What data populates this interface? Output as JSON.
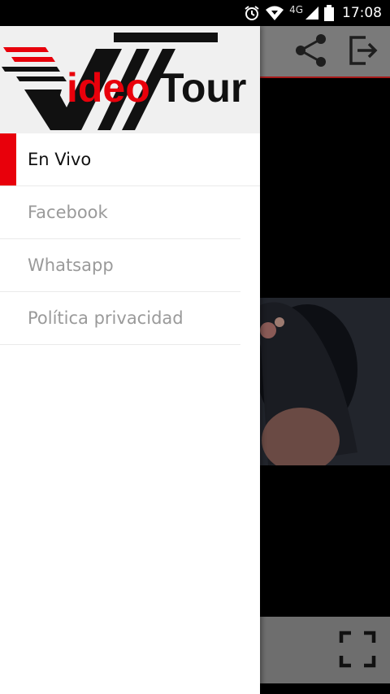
{
  "status_bar": {
    "time": "17:08",
    "network": "4G",
    "icons": [
      "alarm-icon",
      "wifi-icon",
      "signal-icon",
      "battery-icon"
    ]
  },
  "toolbar": {
    "actions": [
      "share-icon",
      "exit-icon"
    ]
  },
  "player": {
    "controls": [
      "fullscreen-icon"
    ]
  },
  "drawer": {
    "logo": {
      "text_prefix": "V",
      "text_red": "ideo",
      "text_black": "Tour"
    },
    "menu": [
      {
        "label": "En Vivo",
        "active": true
      },
      {
        "label": "Facebook",
        "active": false
      },
      {
        "label": "Whatsapp",
        "active": false
      },
      {
        "label": "Política privacidad",
        "active": false
      }
    ]
  },
  "colors": {
    "accent": "#e8000b",
    "toolbar_underline": "#a71a1a",
    "menu_text_inactive": "#9a9a9a",
    "menu_text_active": "#111111"
  }
}
